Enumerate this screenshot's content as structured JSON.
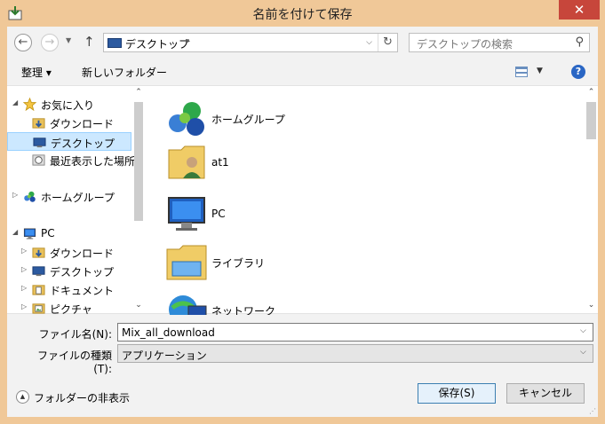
{
  "window": {
    "title": "名前を付けて保存",
    "close_glyph": "✕"
  },
  "address": {
    "location": "デスクトップ",
    "sep": "▸",
    "search_placeholder": "デスクトップの検索"
  },
  "toolbar": {
    "organize": "整理 ▾",
    "new_folder": "新しいフォルダー"
  },
  "nav_items": [
    {
      "label": "お気に入り",
      "exp": "◢",
      "icon": "star-icon",
      "indent": 0
    },
    {
      "label": "ダウンロード",
      "exp": "",
      "icon": "downloads-folder-icon",
      "indent": 1
    },
    {
      "label": "デスクトップ",
      "exp": "",
      "icon": "desktop-icon",
      "indent": 1,
      "selected": true
    },
    {
      "label": "最近表示した場所",
      "exp": "",
      "icon": "recent-places-icon",
      "indent": 1
    },
    {
      "label": "ホームグループ",
      "exp": "▷",
      "icon": "homegroup-icon",
      "indent": 0
    },
    {
      "label": "PC",
      "exp": "◢",
      "icon": "pc-icon",
      "indent": 0
    },
    {
      "label": "ダウンロード",
      "exp": "▷",
      "icon": "downloads-folder-icon",
      "indent": 1
    },
    {
      "label": "デスクトップ",
      "exp": "▷",
      "icon": "desktop-icon",
      "indent": 1
    },
    {
      "label": "ドキュメント",
      "exp": "▷",
      "icon": "documents-folder-icon",
      "indent": 1
    },
    {
      "label": "ピクチャ",
      "exp": "▷",
      "icon": "pictures-folder-icon",
      "indent": 1
    }
  ],
  "content_items": [
    {
      "label": "ホームグループ",
      "icon": "homegroup-icon"
    },
    {
      "label": "at1",
      "icon": "user-folder-icon"
    },
    {
      "label": "PC",
      "icon": "pc-icon"
    },
    {
      "label": "ライブラリ",
      "icon": "libraries-icon"
    },
    {
      "label": "ネットワーク",
      "icon": "network-icon"
    }
  ],
  "form": {
    "filename_label": "ファイル名(N):",
    "filename_value": "Mix_all_download",
    "filetype_label": "ファイルの種類(T):",
    "filetype_value": "アプリケーション"
  },
  "footer": {
    "hide_folders": "フォルダーの非表示",
    "save": "保存(S)",
    "cancel": "キャンセル"
  },
  "colors": {
    "frame": "#f0c898",
    "close": "#c7463b",
    "selection": "#cce8ff",
    "help": "#2a66c4"
  }
}
